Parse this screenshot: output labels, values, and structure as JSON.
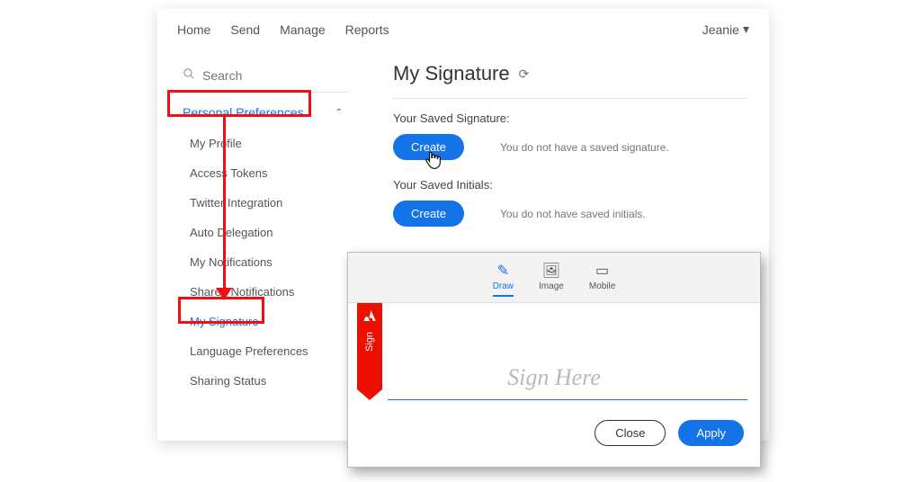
{
  "nav": {
    "home": "Home",
    "send": "Send",
    "manage": "Manage",
    "reports": "Reports"
  },
  "user": {
    "name": "Jeanie"
  },
  "sidebar": {
    "search_placeholder": "Search",
    "section_title": "Personal Preferences",
    "items": [
      "My Profile",
      "Access Tokens",
      "Twitter Integration",
      "Auto Delegation",
      "My Notifications",
      "Shared Notifications",
      "My Signature",
      "Language Preferences",
      "Sharing Status"
    ]
  },
  "main": {
    "title": "My Signature",
    "sig_label": "Your Saved Signature:",
    "sig_hint": "You do not have a saved signature.",
    "initials_label": "Your Saved Initials:",
    "initials_hint": "You do not have saved initials.",
    "create_label": "Create"
  },
  "dialog": {
    "tabs": {
      "draw": "Draw",
      "image": "Image",
      "mobile": "Mobile"
    },
    "tag": "Sign",
    "placeholder": "Sign Here",
    "close": "Close",
    "apply": "Apply"
  }
}
